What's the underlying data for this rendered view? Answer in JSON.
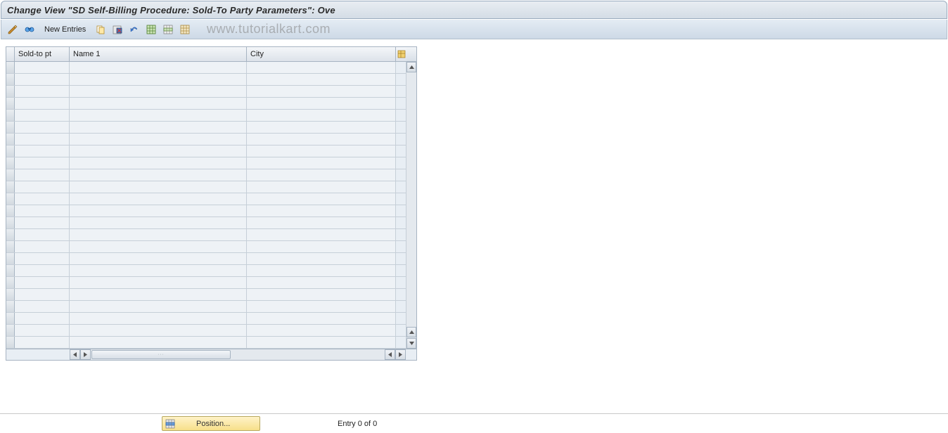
{
  "header": {
    "title": "Change View \"SD Self-Billing Procedure: Sold-To Party Parameters\": Ove"
  },
  "toolbar": {
    "new_entries_label": "New Entries"
  },
  "watermark": "www.tutorialkart.com",
  "table": {
    "columns": {
      "sold_to": "Sold-to pt",
      "name1": "Name 1",
      "city": "City"
    },
    "rows": []
  },
  "footer": {
    "position_label": "Position...",
    "entry_text": "Entry 0 of 0"
  }
}
